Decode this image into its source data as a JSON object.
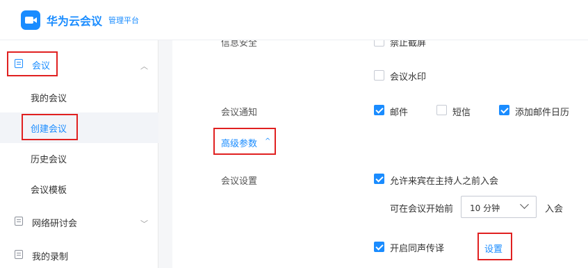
{
  "header": {
    "brand_name": "华为云会议",
    "brand_sub": "管理平台"
  },
  "sidebar": {
    "meeting": "会议",
    "sub_items": [
      "我的会议",
      "创建会议",
      "历史会议",
      "会议模板"
    ],
    "webinar": "网络研讨会",
    "recording": "我的录制"
  },
  "main": {
    "info_security_label": "信息安全",
    "no_screenshot_label": "禁止截屏",
    "watermark_label": "会议水印",
    "notify_label": "会议通知",
    "notify_email": "邮件",
    "notify_sms": "短信",
    "notify_calendar": "添加邮件日历",
    "advanced_label": "高级参数",
    "advanced_chevron": "^",
    "settings_label": "会议设置",
    "allow_guest": "允许来宾在主持人之前入会",
    "before_start": "可在会议开始前",
    "minutes_value": "10 分钟",
    "join_suffix": "入会",
    "interpretation": "开启同声传译",
    "settings_link": "设置"
  },
  "state": {
    "no_screenshot": false,
    "watermark": false,
    "notify_email": true,
    "notify_sms": false,
    "notify_calendar": true,
    "allow_guest": true,
    "interpretation": true
  },
  "colors": {
    "accent": "#1a8cff",
    "highlight_box": "#e02020"
  },
  "icons": {
    "logo": "video-camera-icon",
    "meeting": "calendar-icon",
    "webinar": "webinar-icon",
    "recording": "recording-icon"
  }
}
